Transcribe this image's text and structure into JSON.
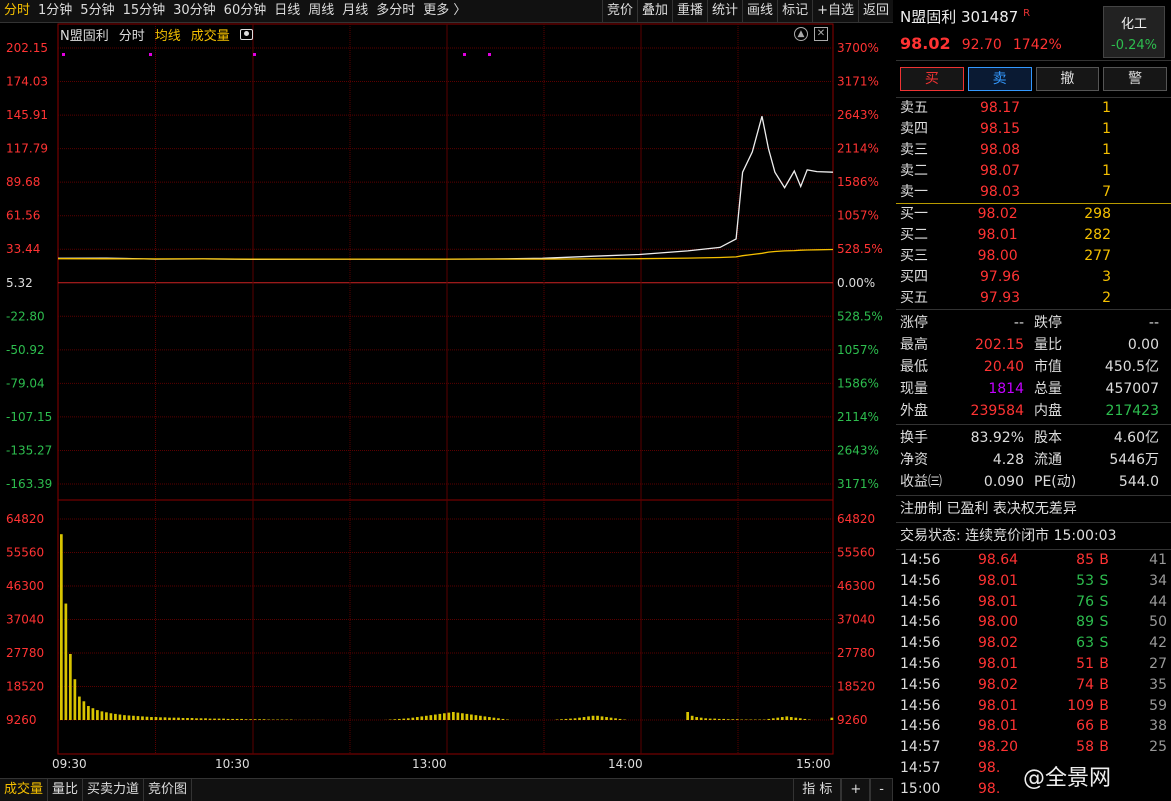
{
  "toolbar": {
    "periods": [
      "分时",
      "1分钟",
      "5分钟",
      "15分钟",
      "30分钟",
      "60分钟",
      "日线",
      "周线",
      "月线",
      "多分时",
      "更多 〉"
    ],
    "actions": [
      "竞价",
      "叠加",
      "重播",
      "统计",
      "画线",
      "标记",
      "+自选",
      "返回"
    ]
  },
  "legend": {
    "stock": "N盟固利",
    "mode": "分时",
    "avg": "均线",
    "vol": "成交量"
  },
  "price_axis": {
    "left": [
      "202.15",
      "174.03",
      "145.91",
      "117.79",
      "89.68",
      "61.56",
      "33.44",
      "5.32",
      "-22.80",
      "-50.92",
      "-79.04",
      "-107.15",
      "-135.27",
      "-163.39"
    ],
    "right": [
      "3700%",
      "3171%",
      "2643%",
      "2114%",
      "1586%",
      "1057%",
      "528.5%",
      "0.00%",
      "528.5%",
      "1057%",
      "1586%",
      "2114%",
      "2643%",
      "3171%"
    ]
  },
  "vol_axis": [
    "64820",
    "55560",
    "46300",
    "37040",
    "27780",
    "18520",
    "9260"
  ],
  "time_axis": [
    "09:30",
    "10:30",
    "13:00",
    "14:00",
    "15:00"
  ],
  "chart_data": {
    "type": "line",
    "x": [
      "09:30",
      "09:45",
      "10:00",
      "10:15",
      "10:30",
      "10:45",
      "11:00",
      "11:15",
      "11:30",
      "13:15",
      "13:30",
      "13:45",
      "14:00",
      "14:15",
      "14:25",
      "14:30",
      "14:32",
      "14:35",
      "14:38",
      "14:40",
      "14:42",
      "14:45",
      "14:48",
      "14:50",
      "14:52",
      "14:55",
      "15:00"
    ],
    "series": [
      {
        "values": [
          25.8,
          26.0,
          25.2,
          25.3,
          25.0,
          25.1,
          25.2,
          25.1,
          25.2,
          25.3,
          25.8,
          27.5,
          29.0,
          32.0,
          35.0,
          42.0,
          98.0,
          115.0,
          145.0,
          118.0,
          98.0,
          85.0,
          99.0,
          86.0,
          100.0,
          98.5,
          98.0
        ]
      },
      {
        "values": [
          25.5,
          25.4,
          25.3,
          25.3,
          25.2,
          25.2,
          25.2,
          25.2,
          25.2,
          25.2,
          25.2,
          25.3,
          25.5,
          26.0,
          26.5,
          27.0,
          28.0,
          29.0,
          30.0,
          31.0,
          31.5,
          32.0,
          32.3,
          32.6,
          32.8,
          33.0,
          33.2
        ]
      }
    ],
    "volume": [
      60000,
      38000,
      22000,
      14000,
      8500,
      7000,
      5500,
      4800,
      4200,
      3800,
      3500,
      3200,
      3000,
      2800,
      2600,
      2500,
      2400,
      2300,
      2200,
      2100,
      2000,
      2000,
      1900,
      1900,
      1800,
      1800,
      1800,
      1700,
      1700,
      1700,
      1600,
      1600,
      1600,
      1500,
      1500,
      1500,
      1500,
      1400,
      1400,
      1400,
      1400,
      1300,
      1300,
      1300,
      1300,
      1300,
      1200,
      1200,
      1200,
      1200,
      1200,
      1200,
      1100,
      1100,
      1100,
      1100,
      1100,
      1100,
      1100,
      1000,
      1000,
      1000,
      1000,
      1000,
      1000,
      1000,
      1000,
      1000,
      1000,
      1000,
      1000,
      1000,
      1100,
      1200,
      1300,
      1400,
      1500,
      1600,
      1800,
      2000,
      2200,
      2400,
      2600,
      2800,
      3000,
      3200,
      3400,
      3600,
      3400,
      3200,
      3000,
      2800,
      2600,
      2400,
      2200,
      2000,
      1800,
      1600,
      1400,
      1200,
      1000,
      1000,
      1000,
      1000,
      1000,
      1000,
      1000,
      1000,
      1000,
      1000,
      1200,
      1300,
      1400,
      1500,
      1600,
      1800,
      2000,
      2200,
      2400,
      2400,
      2200,
      2000,
      1800,
      1600,
      1400,
      1200,
      1000,
      1000,
      1000,
      1000,
      1000,
      1000,
      1000,
      1000,
      1000,
      1000,
      1000,
      1000,
      1000,
      3600,
      2400,
      2000,
      1800,
      1600,
      1500,
      1500,
      1400,
      1400,
      1300,
      1300,
      1300,
      1200,
      1200,
      1200,
      1200,
      1200,
      1200,
      1400,
      1600,
      1800,
      2000,
      2200,
      2000,
      1800,
      1600,
      1400,
      1200,
      1000,
      1000,
      1000,
      1000,
      1800
    ]
  },
  "bottom_tabs": [
    "成交量",
    "量比",
    "买卖力道",
    "竞价图"
  ],
  "bottom_right": [
    "指 标",
    "+",
    "-"
  ],
  "stock": {
    "name": "N盟固利",
    "code": "301487",
    "tag": "R",
    "price": "98.02",
    "change": "92.70",
    "pct": "1742%",
    "sector": "化工",
    "sector_pct": "-0.24%"
  },
  "buttons": [
    "买",
    "卖",
    "撤",
    "警"
  ],
  "sell_orders": [
    {
      "label": "卖五",
      "price": "98.17",
      "vol": "1"
    },
    {
      "label": "卖四",
      "price": "98.15",
      "vol": "1"
    },
    {
      "label": "卖三",
      "price": "98.08",
      "vol": "1"
    },
    {
      "label": "卖二",
      "price": "98.07",
      "vol": "1"
    },
    {
      "label": "卖一",
      "price": "98.03",
      "vol": "7"
    }
  ],
  "buy_orders": [
    {
      "label": "买一",
      "price": "98.02",
      "vol": "298"
    },
    {
      "label": "买二",
      "price": "98.01",
      "vol": "282"
    },
    {
      "label": "买三",
      "price": "98.00",
      "vol": "277"
    },
    {
      "label": "买四",
      "price": "97.96",
      "vol": "3"
    },
    {
      "label": "买五",
      "price": "97.93",
      "vol": "2"
    }
  ],
  "stats1": [
    {
      "l": "涨停",
      "v": "--",
      "vc": "white",
      "l2": "跌停",
      "v2": "--",
      "v2c": "white"
    },
    {
      "l": "最高",
      "v": "202.15",
      "vc": "red",
      "l2": "量比",
      "v2": "0.00",
      "v2c": "white"
    },
    {
      "l": "最低",
      "v": "20.40",
      "vc": "red",
      "l2": "市值",
      "v2": "450.5亿",
      "v2c": "white"
    },
    {
      "l": "现量",
      "v": "1814",
      "vc": "purple",
      "l2": "总量",
      "v2": "457007",
      "v2c": "white"
    },
    {
      "l": "外盘",
      "v": "239584",
      "vc": "red",
      "l2": "内盘",
      "v2": "217423",
      "v2c": "green"
    }
  ],
  "stats2": [
    {
      "l": "换手",
      "v": "83.92%",
      "vc": "white",
      "l2": "股本",
      "v2": "4.60亿",
      "v2c": "white"
    },
    {
      "l": "净资",
      "v": "4.28",
      "vc": "white",
      "l2": "流通",
      "v2": "5446万",
      "v2c": "white"
    },
    {
      "l": "收益㈢",
      "v": "0.090",
      "vc": "white",
      "l2": "PE(动)",
      "v2": "544.0",
      "v2c": "white"
    }
  ],
  "notes": [
    "注册制 已盈利 表决权无差异",
    "交易状态: 连续竞价闭市 15:00:03"
  ],
  "ticks": [
    {
      "t": "14:56",
      "p": "98.64",
      "q": "85",
      "d": "B",
      "n": "41"
    },
    {
      "t": "14:56",
      "p": "98.01",
      "q": "53",
      "d": "S",
      "n": "34"
    },
    {
      "t": "14:56",
      "p": "98.01",
      "q": "76",
      "d": "S",
      "n": "44"
    },
    {
      "t": "14:56",
      "p": "98.00",
      "q": "89",
      "d": "S",
      "n": "50"
    },
    {
      "t": "14:56",
      "p": "98.02",
      "q": "63",
      "d": "S",
      "n": "42"
    },
    {
      "t": "14:56",
      "p": "98.01",
      "q": "51",
      "d": "B",
      "n": "27"
    },
    {
      "t": "14:56",
      "p": "98.02",
      "q": "74",
      "d": "B",
      "n": "35"
    },
    {
      "t": "14:56",
      "p": "98.01",
      "q": "109",
      "d": "B",
      "n": "59"
    },
    {
      "t": "14:56",
      "p": "98.01",
      "q": "66",
      "d": "B",
      "n": "38"
    },
    {
      "t": "14:57",
      "p": "98.20",
      "q": "58",
      "d": "B",
      "n": "25"
    },
    {
      "t": "14:57",
      "p": "98.",
      "q": "",
      "d": "",
      "n": ""
    },
    {
      "t": "15:00",
      "p": "98.",
      "q": "",
      "d": "",
      "n": ""
    }
  ],
  "watermark": "@全景网"
}
